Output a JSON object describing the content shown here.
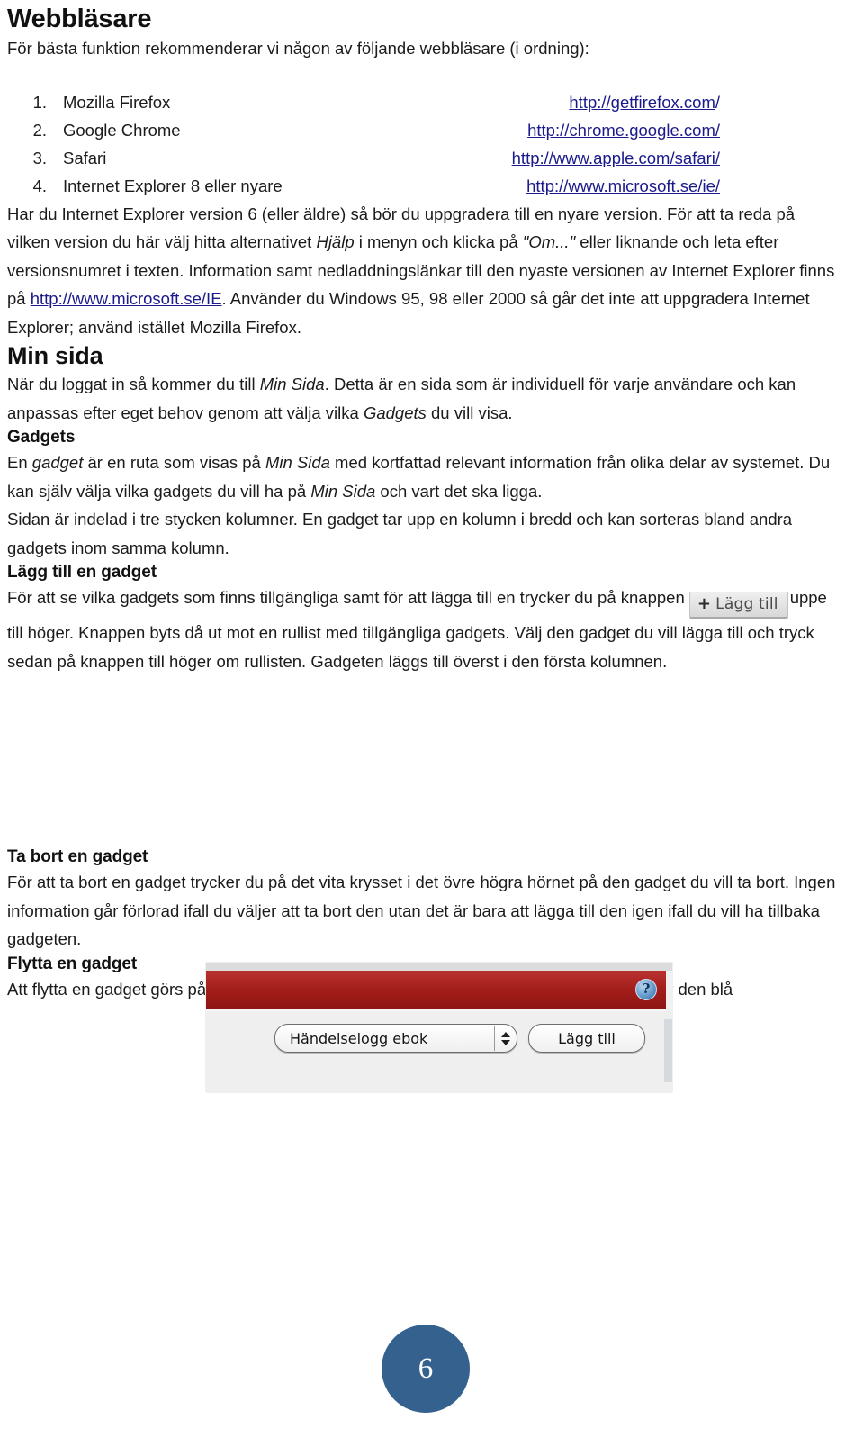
{
  "document": {
    "page_number": "6",
    "accent_color": "#35618F",
    "link_color": "#1a1a8c"
  },
  "sections": {
    "browsers": {
      "heading": "Webbläsare",
      "intro": "För bästa funktion rekommenderar vi någon av följande webbläsare (i ordning):",
      "items": [
        {
          "num": "1.",
          "name": "Mozilla Firefox",
          "url": "http://getfirefox.com",
          "url_suffix": "/"
        },
        {
          "num": "2.",
          "name": "Google Chrome",
          "url": "http://chrome.google.com/",
          "url_suffix": ""
        },
        {
          "num": "3.",
          "name": "Safari",
          "url": "http://www.apple.com/safari/",
          "url_suffix": ""
        },
        {
          "num": "4.",
          "name": "Internet Explorer 8 eller nyare",
          "url": "http://www.microsoft.se/ie/",
          "url_suffix": ""
        }
      ],
      "paragraph": {
        "p1": "Har du Internet Explorer version 6 (eller äldre) så bör du uppgradera till en nyare version. För att ta reda på vilken version du här välj hitta alternativet ",
        "em1": "Hjälp",
        "p2": " i menyn och klicka på ",
        "em2": "\"Om...\"",
        "p3": " eller liknande och leta efter versionsnumret i texten. Information samt nedladdningslänkar till den nyaste versionen av Internet Explorer finns på ",
        "link": "http://www.microsoft.se/IE",
        "p4": ". Använder du Windows 95, 98 eller 2000 så går det inte att uppgradera Internet Explorer; använd istället Mozilla Firefox."
      }
    },
    "min_sida": {
      "heading": "Min sida",
      "p1": "När du loggat in så kommer du till ",
      "em1": "Min Sida",
      "p2": ". Detta är en sida som är individuell för varje användare och kan anpassas efter eget behov genom att välja vilka ",
      "em2": "Gadgets",
      "p3": " du vill visa."
    },
    "gadgets": {
      "heading": "Gadgets",
      "p1": "En ",
      "em1": "gadget",
      "p2": " är en ruta som visas på ",
      "em2": "Min Sida",
      "p3": " med kortfattad relevant information från olika delar av systemet. Du kan själv välja vilka gadgets du vill ha på ",
      "em3": "Min Sida",
      "p4": " och vart det ska ligga.",
      "p5": "Sidan är indelad i tre stycken kolumner. En gadget tar upp en kolumn i bredd och kan sorteras bland andra gadgets inom samma kolumn."
    },
    "add_gadget": {
      "heading": "Lägg till en gadget",
      "p1": "För att se vilka gadgets som finns tillgängliga samt för att lägga till en trycker du på knappen",
      "button_plus": "+",
      "button_label": "Lägg till",
      "p2": "uppe till höger. Knappen byts då ut mot en rullist med tillgängliga gadgets. Välj den gadget du vill lägga till och tryck sedan på knappen till höger om rullisten. Gadgeten läggs till överst i den första kolumnen."
    },
    "screenshot": {
      "select_value": "Händelselogg ebok",
      "add_button_label": "Lägg till",
      "help_icon": "?",
      "titlebar_color": "#a01c19"
    },
    "remove_gadget": {
      "heading": "Ta bort en gadget",
      "p1": "För att ta bort en gadget trycker du på det vita krysset i det övre högra hörnet på den gadget du vill ta bort. Ingen information går förlorad ifall du väljer att ta bort den utan det är bara att lägga till den igen ifall du vill ha tillbaka gadgeten."
    },
    "move_gadget": {
      "heading": "Flytta en gadget",
      "p1": "Att flytta en gadget görs på samma sätt som du är van att flytta ett fönster. För musen över den blå"
    }
  }
}
